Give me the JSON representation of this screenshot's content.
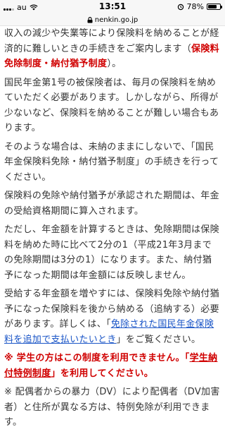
{
  "status_bar": {
    "carrier": "au",
    "time": "13:51",
    "battery": "78%",
    "battery_level": 0.78
  },
  "url_bar": {
    "domain": "nenkin.go.jp"
  },
  "paragraph1": {
    "text": "収入の減少や失業等により保険料を納めることが経済的に難しいときの手続きをご案内します（",
    "highlight": "保険料免除制度・納付猶予制度",
    "tail": "）。"
  },
  "paragraph2": "国民年金第1号の被保険者は、毎月の保険料を納めていただく必要があります。しかしながら、所得が少ないなど、保険料を納めることが難しい場合もあります。",
  "paragraph3": "そのような場合は、未納のままにしないで、「国民年金保険料免除・納付猶予制度」の手続きを行ってください。",
  "paragraph4": "保険料の免除や納付猶予が承認された期間は、年金の受給資格期間に算入されます。",
  "paragraph5": "ただし、年金額を計算するときは、免除期間は保険料を納めた時に比べて2分の1（平成21年3月までの免除期間は3分の1）になります。また、納付猶予になった期間は年金額には反映しません。",
  "paragraph6": {
    "text": "受給する年金額を増やすには、保険料免除や納付猶予になった保険料を後から納める（追納する）必要があります。詳しくは、",
    "link_open": "「",
    "link_label": "免除された国民年金保険料を追加で支払いたいとき",
    "link_close": "」をご覧ください。"
  },
  "notice1": {
    "text": "※ 学生の方はこの制度を利用できません。「",
    "link_label": "学生納付特例制度",
    "tail": "」を利用してください。"
  },
  "notice2": "※ 配偶者からの暴力（DV）により配偶者（DV加害者）と住所が異なる方は、特例免除が利用できます。"
}
